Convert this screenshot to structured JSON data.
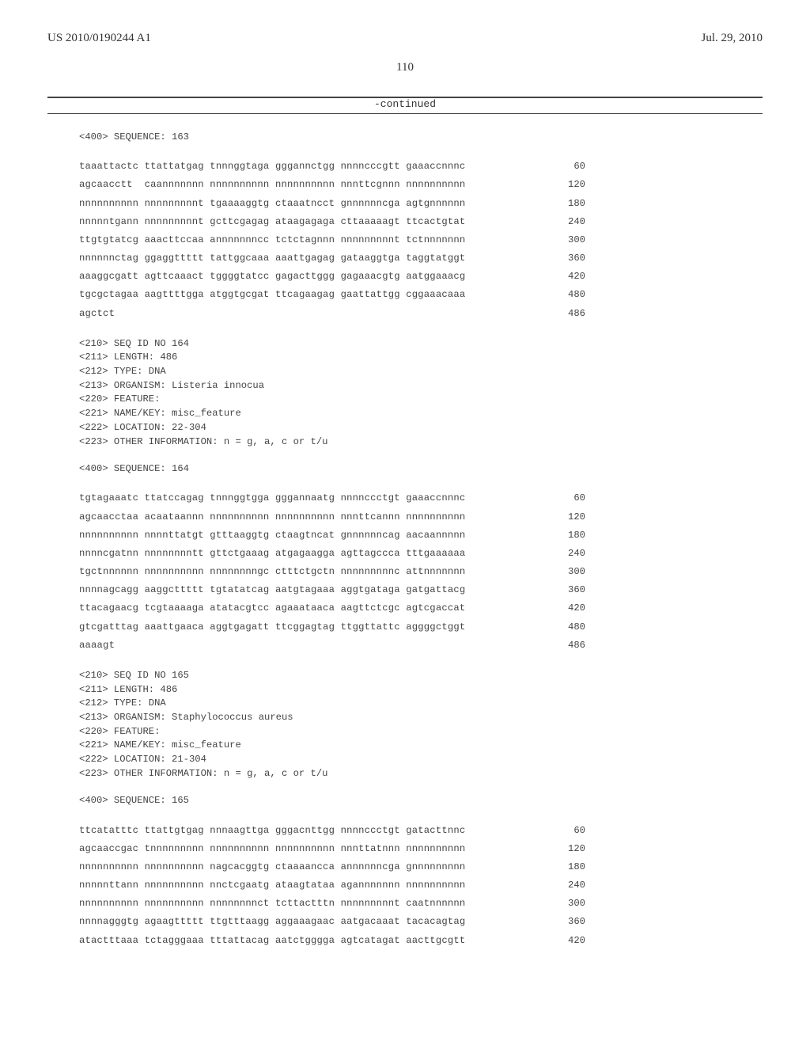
{
  "header": {
    "pub_number": "US 2010/0190244 A1",
    "pub_date": "Jul. 29, 2010"
  },
  "page_number": "110",
  "continued_label": "-continued",
  "seq163": {
    "header": "<400> SEQUENCE: 163",
    "lines": [
      {
        "t": "taaattactc ttattatgag tnnnggtaga gggannctgg nnnncccgtt gaaaccnnnc",
        "p": "60"
      },
      {
        "t": "agcaacctt  caannnnnnn nnnnnnnnnn nnnnnnnnnn nnnttcgnnn nnnnnnnnnn",
        "p": "120"
      },
      {
        "t": "nnnnnnnnnn nnnnnnnnnt tgaaaaggtg ctaaatncct gnnnnnncga agtgnnnnnn",
        "p": "180"
      },
      {
        "t": "nnnnntgann nnnnnnnnnt gcttcgagag ataagagaga cttaaaaagt ttcactgtat",
        "p": "240"
      },
      {
        "t": "ttgtgtatcg aaacttccaa annnnnnncc tctctagnnn nnnnnnnnnt tctnnnnnnn",
        "p": "300"
      },
      {
        "t": "nnnnnnctag ggaggttttt tattggcaaa aaattgagag gataaggtga taggtatggt",
        "p": "360"
      },
      {
        "t": "aaaggcgatt agttcaaact tggggtatcc gagacttggg gagaaacgtg aatggaaacg",
        "p": "420"
      },
      {
        "t": "tgcgctagaa aagttttgga atggtgcgat ttcagaagag gaattattgg cggaaacaaa",
        "p": "480"
      },
      {
        "t": "agctct",
        "p": "486"
      }
    ]
  },
  "seq164": {
    "meta": "<210> SEQ ID NO 164\n<211> LENGTH: 486\n<212> TYPE: DNA\n<213> ORGANISM: Listeria innocua\n<220> FEATURE:\n<221> NAME/KEY: misc_feature\n<222> LOCATION: 22-304\n<223> OTHER INFORMATION: n = g, a, c or t/u",
    "header": "<400> SEQUENCE: 164",
    "lines": [
      {
        "t": "tgtagaaatc ttatccagag tnnnggtgga gggannaatg nnnnccctgt gaaaccnnnc",
        "p": "60"
      },
      {
        "t": "agcaacctaa acaataannn nnnnnnnnnn nnnnnnnnnn nnnttcannn nnnnnnnnnn",
        "p": "120"
      },
      {
        "t": "nnnnnnnnnn nnnnttatgt gtttaaggtg ctaagtncat gnnnnnncag aacaannnnn",
        "p": "180"
      },
      {
        "t": "nnnncgatnn nnnnnnnntt gttctgaaag atgagaagga agttagccca tttgaaaaaa",
        "p": "240"
      },
      {
        "t": "tgctnnnnnn nnnnnnnnnn nnnnnnnngc ctttctgctn nnnnnnnnnc attnnnnnnn",
        "p": "300"
      },
      {
        "t": "nnnnagcagg aaggcttttt tgtatatcag aatgtagaaa aggtgataga gatgattacg",
        "p": "360"
      },
      {
        "t": "ttacagaacg tcgtaaaaga atatacgtcc agaaataaca aagttctcgc agtcgaccat",
        "p": "420"
      },
      {
        "t": "gtcgatttag aaattgaaca aggtgagatt ttcggagtag ttggttattc aggggctggt",
        "p": "480"
      },
      {
        "t": "aaaagt",
        "p": "486"
      }
    ]
  },
  "seq165": {
    "meta": "<210> SEQ ID NO 165\n<211> LENGTH: 486\n<212> TYPE: DNA\n<213> ORGANISM: Staphylococcus aureus\n<220> FEATURE:\n<221> NAME/KEY: misc_feature\n<222> LOCATION: 21-304\n<223> OTHER INFORMATION: n = g, a, c or t/u",
    "header": "<400> SEQUENCE: 165",
    "lines": [
      {
        "t": "ttcatatttc ttattgtgag nnnaagttga gggacnttgg nnnnccctgt gatacttnnc",
        "p": "60"
      },
      {
        "t": "agcaaccgac tnnnnnnnnn nnnnnnnnnn nnnnnnnnnn nnnttatnnn nnnnnnnnnn",
        "p": "120"
      },
      {
        "t": "nnnnnnnnnn nnnnnnnnnn nagcacggtg ctaaaancca annnnnncga gnnnnnnnnn",
        "p": "180"
      },
      {
        "t": "nnnnnttann nnnnnnnnnn nnctcgaatg ataagtataa agannnnnnn nnnnnnnnnn",
        "p": "240"
      },
      {
        "t": "nnnnnnnnnn nnnnnnnnnn nnnnnnnnct tcttactttn nnnnnnnnnt caatnnnnnn",
        "p": "300"
      },
      {
        "t": "nnnnagggtg agaagttttt ttgtttaagg aggaaagaac aatgacaaat tacacagtag",
        "p": "360"
      },
      {
        "t": "atactttaaa tctagggaaa tttattacag aatctgggga agtcatagat aacttgcgtt",
        "p": "420"
      }
    ]
  }
}
